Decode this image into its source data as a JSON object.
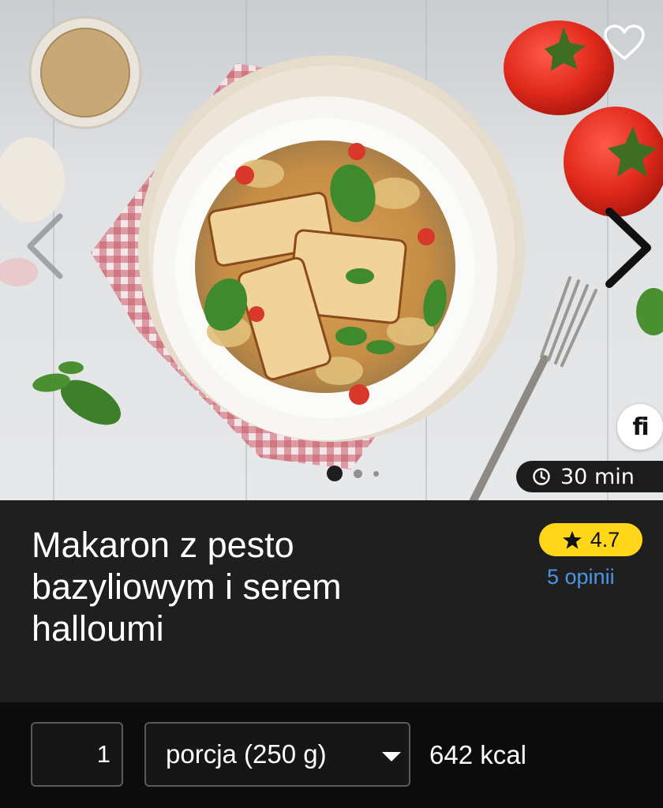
{
  "hero": {
    "time": "30 min",
    "brand_logo_text": "fi",
    "carousel": {
      "total_slides": 3,
      "active_slide": 1
    }
  },
  "recipe": {
    "title": "Makaron z pesto bazyliowym i serem halloumi",
    "rating": "4.7",
    "reviews": "5 opinii"
  },
  "portion": {
    "quantity": "1",
    "unit": "porcja (250 g)",
    "calories": "642 kcal"
  },
  "colors": {
    "rating_badge": "#ffd61a",
    "reviews_link": "#4a97e3",
    "info_background": "#1f1f1f",
    "bottom_background": "#0c0c0c"
  },
  "icons": {
    "favorite": "heart-outline-icon",
    "prev": "chevron-left-icon",
    "next": "chevron-right-icon",
    "time": "clock-icon",
    "rating": "star-icon",
    "dropdown": "caret-down-icon"
  }
}
